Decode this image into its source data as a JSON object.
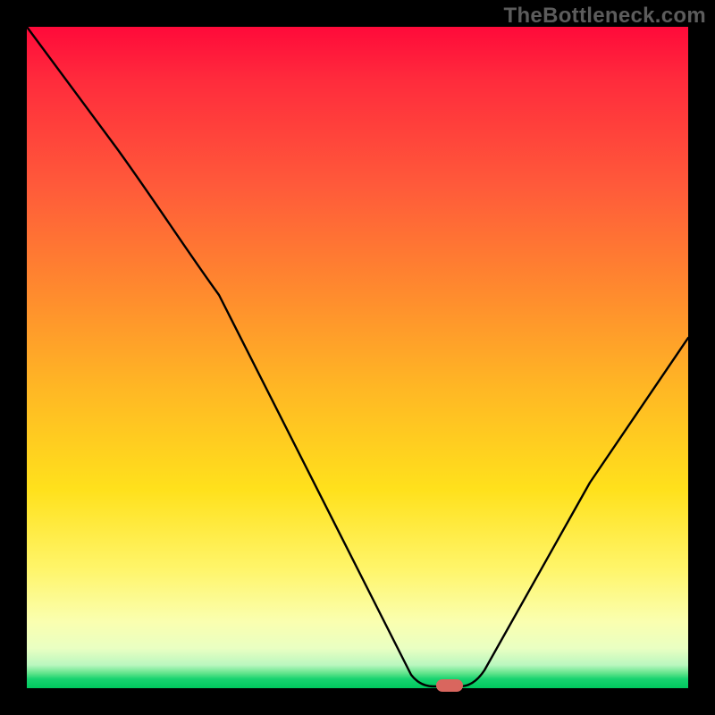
{
  "watermark": "TheBottleneck.com",
  "marker": {
    "x_index": 4,
    "color": "#d9665e"
  },
  "chart_data": {
    "type": "line",
    "title": "",
    "xlabel": "",
    "ylabel": "",
    "xlim": [
      0,
      7
    ],
    "ylim": [
      0,
      100
    ],
    "x": [
      0,
      1,
      2,
      3,
      4,
      5,
      6,
      7
    ],
    "values": [
      100,
      82,
      65,
      30,
      0,
      14,
      32,
      51
    ],
    "annotations": []
  }
}
